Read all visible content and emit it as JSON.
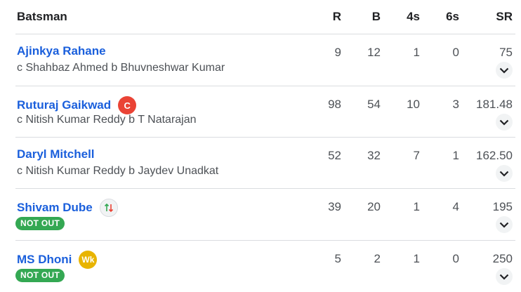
{
  "header": {
    "batsman": "Batsman",
    "r": "R",
    "b": "B",
    "fours": "4s",
    "sixes": "6s",
    "sr": "SR"
  },
  "rows": [
    {
      "name": "Ajinkya Rahane",
      "dismissal": "c Shahbaz Ahmed b Bhuvneshwar Kumar",
      "r": "9",
      "b": "12",
      "fours": "1",
      "sixes": "0",
      "sr": "75",
      "badge": "",
      "icon": "expand-icon"
    },
    {
      "name": "Ruturaj Gaikwad",
      "dismissal": "c Nitish Kumar Reddy b T Natarajan",
      "r": "98",
      "b": "54",
      "fours": "10",
      "sixes": "3",
      "sr": "181.48",
      "badge": "C",
      "icon": "expand-icon"
    },
    {
      "name": "Daryl Mitchell",
      "dismissal": "c Nitish Kumar Reddy b Jaydev Unadkat",
      "r": "52",
      "b": "32",
      "fours": "7",
      "sixes": "1",
      "sr": "162.50",
      "badge": "",
      "icon": "expand-icon"
    },
    {
      "name": "Shivam Dube",
      "status": "NOT OUT",
      "r": "39",
      "b": "20",
      "fours": "1",
      "sixes": "4",
      "sr": "195",
      "badge_icon": "substitute-arrows-icon",
      "icon": "expand-icon"
    },
    {
      "name": "MS Dhoni",
      "status": "NOT OUT",
      "r": "5",
      "b": "2",
      "fours": "1",
      "sixes": "0",
      "sr": "250",
      "badge": "Wk",
      "icon": "expand-icon"
    }
  ],
  "colors": {
    "link": "#1a5fdc",
    "captain": "#ea4335",
    "keeper": "#e8b400",
    "notout": "#34a853",
    "divider": "#dadce0"
  }
}
